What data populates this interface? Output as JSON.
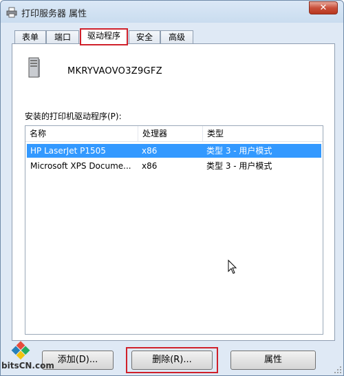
{
  "window": {
    "title": "打印服务器 属性",
    "close_label": "✕"
  },
  "tabs": [
    {
      "label": "表单",
      "active": false
    },
    {
      "label": "端口",
      "active": false
    },
    {
      "label": "驱动程序",
      "active": true
    },
    {
      "label": "安全",
      "active": false
    },
    {
      "label": "高级",
      "active": false
    }
  ],
  "server": {
    "icon": "server-icon",
    "name": "MKRYVAOVO3Z9GFZ"
  },
  "drivers": {
    "section_label": "安装的打印机驱动程序(P):",
    "columns": [
      "名称",
      "处理器",
      "类型"
    ],
    "rows": [
      {
        "name": "HP LaserJet P1505",
        "processor": "x86",
        "type": "类型 3 - 用户模式",
        "selected": true
      },
      {
        "name": "Microsoft XPS Docume...",
        "processor": "x86",
        "type": "类型 3 - 用户模式",
        "selected": false
      }
    ]
  },
  "buttons": {
    "add": "添加(D)...",
    "remove": "删除(R)...",
    "properties": "属性"
  },
  "watermark": {
    "text": "bitsCN.com"
  },
  "colors": {
    "selection": "#3399ff",
    "highlight_box": "#d0202a"
  }
}
